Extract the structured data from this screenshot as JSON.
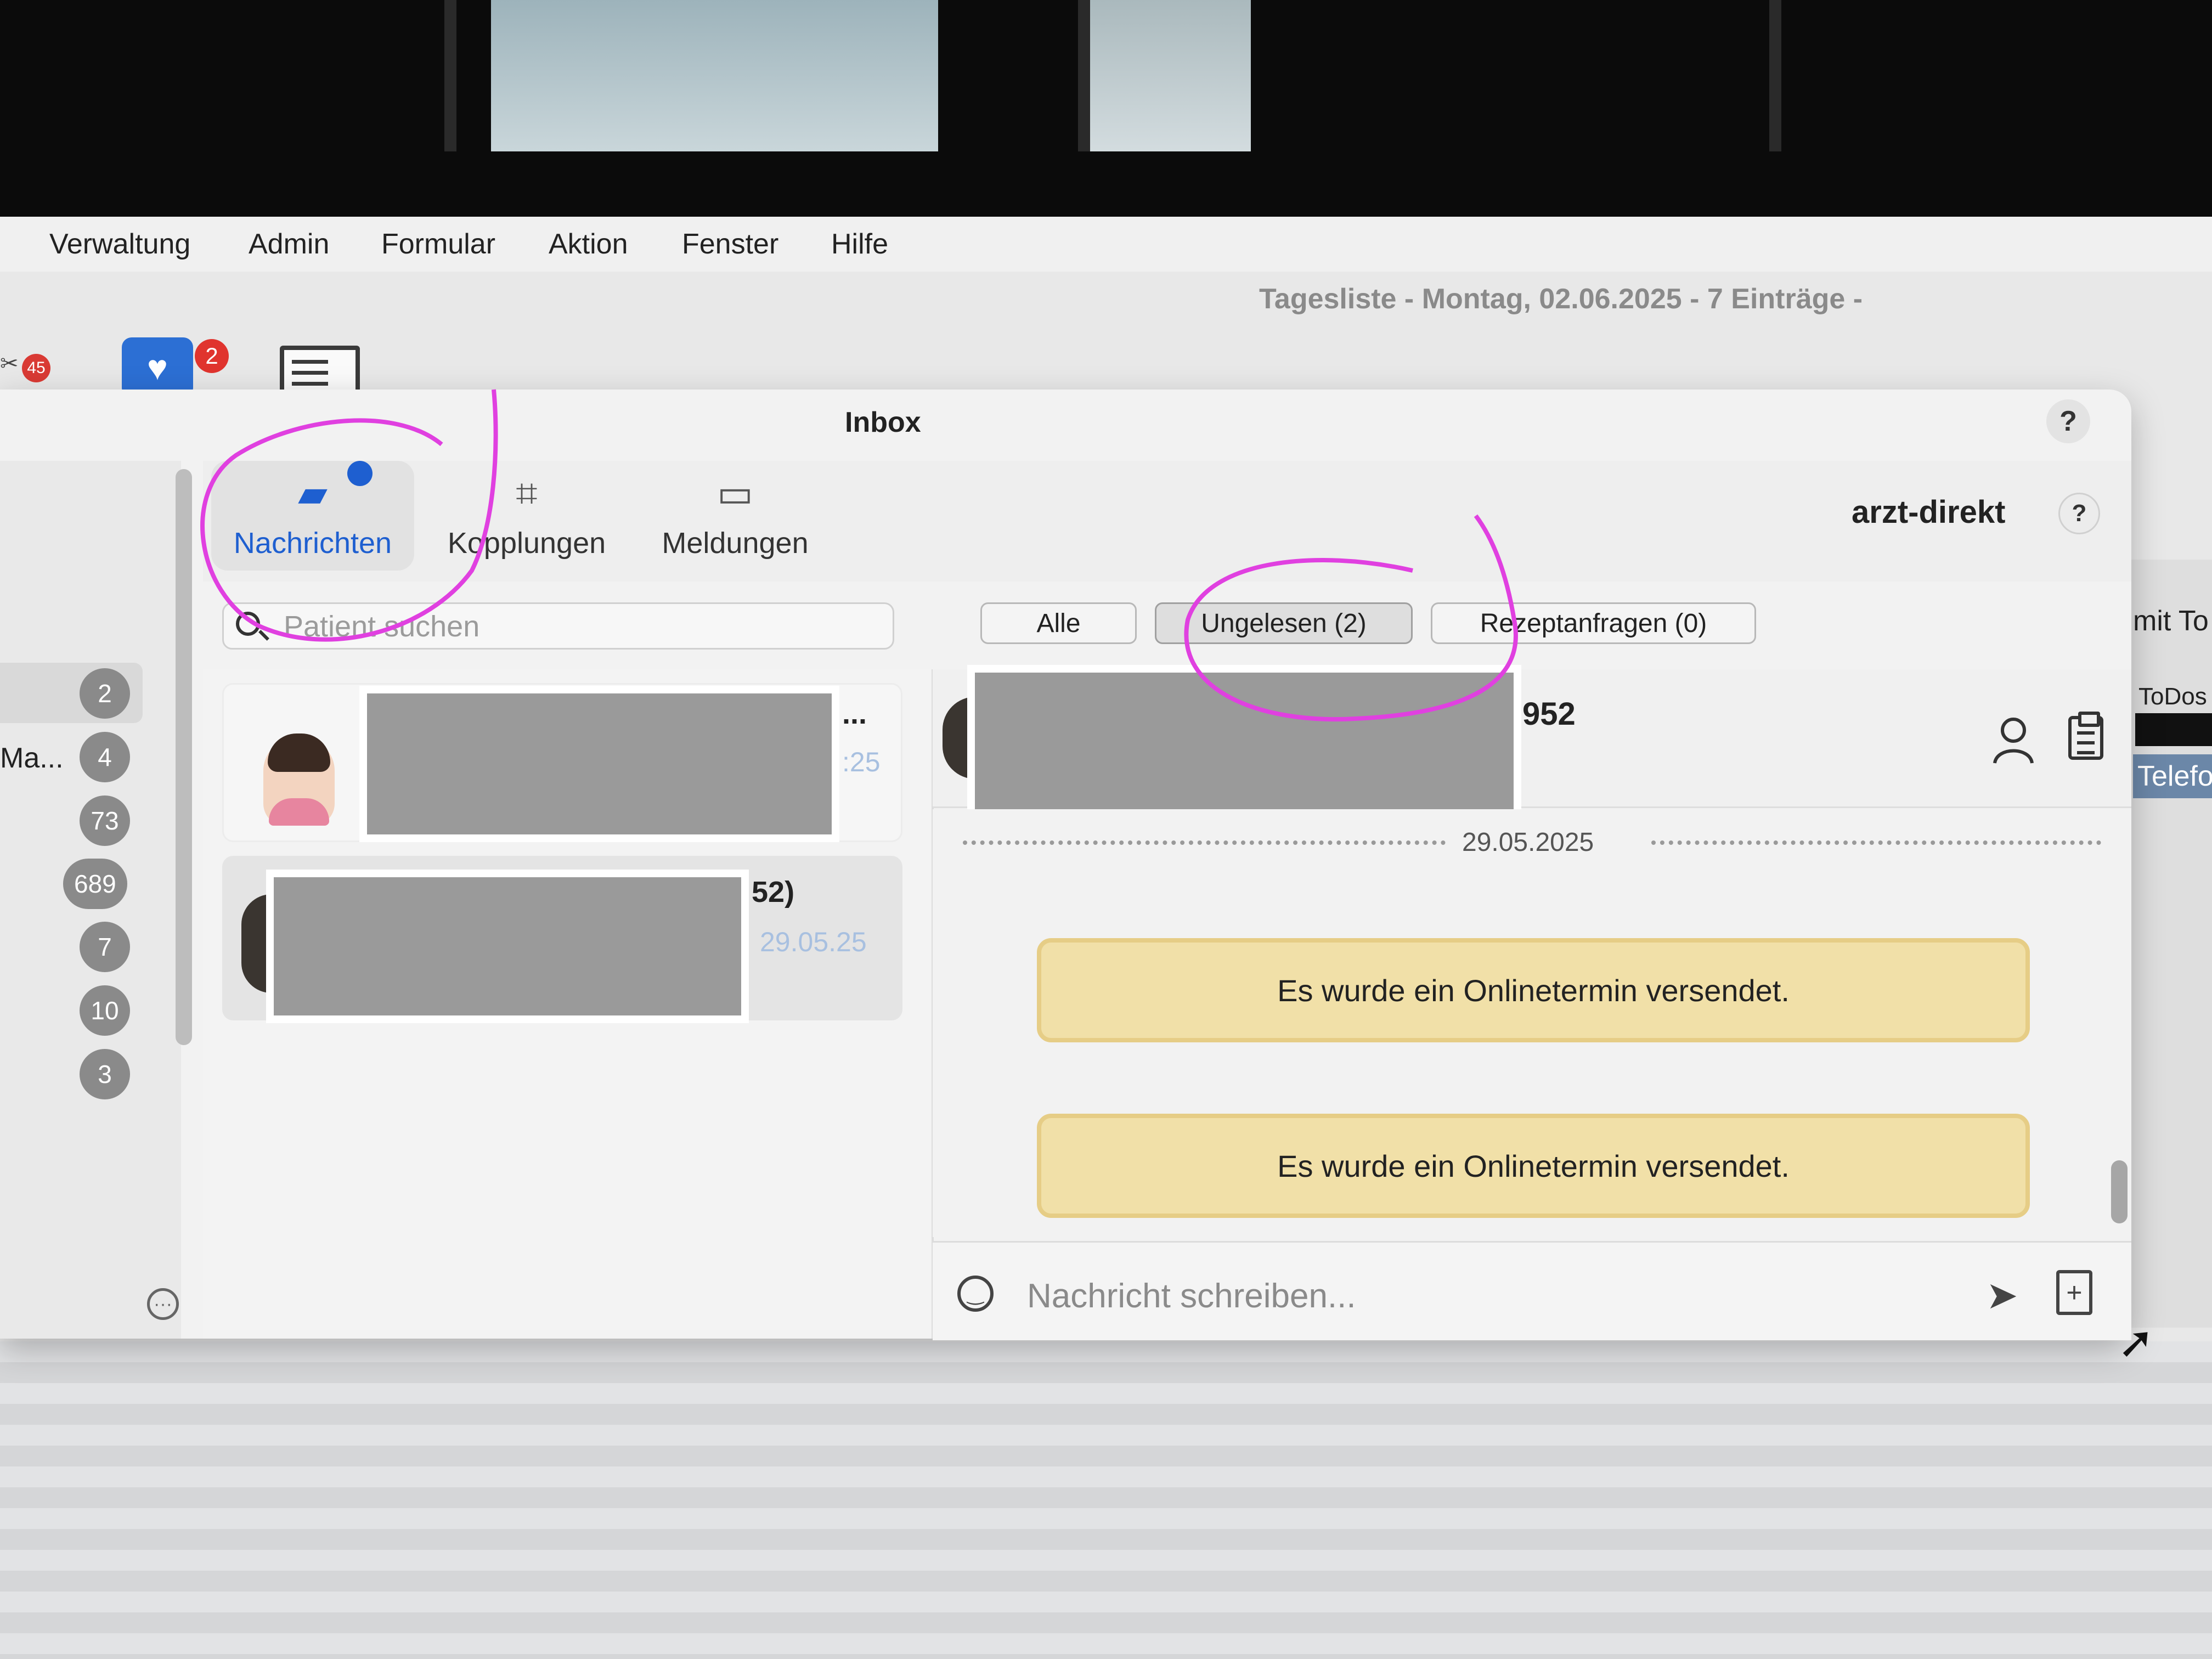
{
  "menu": [
    "Verwaltung",
    "Admin",
    "Formular",
    "Aktion",
    "Fenster",
    "Hilfe"
  ],
  "header": {
    "tagesliste": "Tagesliste - Montag, 02.06.2025 - 7 Einträge -"
  },
  "toolbar": {
    "left_badge": "45",
    "shield_badge": "2"
  },
  "background_panel": {
    "mit": "mit To",
    "todos": "ToDos",
    "telef": "Telefo"
  },
  "inbox": {
    "title": "Inbox",
    "help": "?",
    "provider": "arzt-direkt",
    "tabs": [
      {
        "label": "Nachrichten",
        "icon": "chat-bubbles-icon",
        "active": true,
        "unread_dot": true
      },
      {
        "label": "Kopplungen",
        "icon": "qr-code-icon"
      },
      {
        "label": "Meldungen",
        "icon": "alert-message-icon"
      }
    ],
    "search": {
      "placeholder": "Patient suchen"
    },
    "filters": [
      "Alle",
      "Ungelesen (2)",
      "Rezeptanfragen (0)"
    ],
    "rail": {
      "label_truncated": "Ma...",
      "counts": [
        "2",
        "4",
        "73",
        "689",
        "7",
        "10",
        "3"
      ],
      "more": "···"
    },
    "list": [
      {
        "name_tail": "...",
        "date_tail": ":25"
      },
      {
        "name_tail": "52)",
        "date": "29.05.25"
      }
    ],
    "conversation": {
      "title_tail": "952",
      "date_separator": "29.05.2025",
      "messages": [
        "Es wurde ein Onlinetermin versendet.",
        "Es wurde ein Onlinetermin versendet."
      ],
      "compose_placeholder": "Nachricht schreiben..."
    }
  },
  "colors": {
    "accent": "#1e5fd0",
    "system_message": "#f1e0a8",
    "badge_red": "#e0342e",
    "annotation": "#e040e0"
  }
}
